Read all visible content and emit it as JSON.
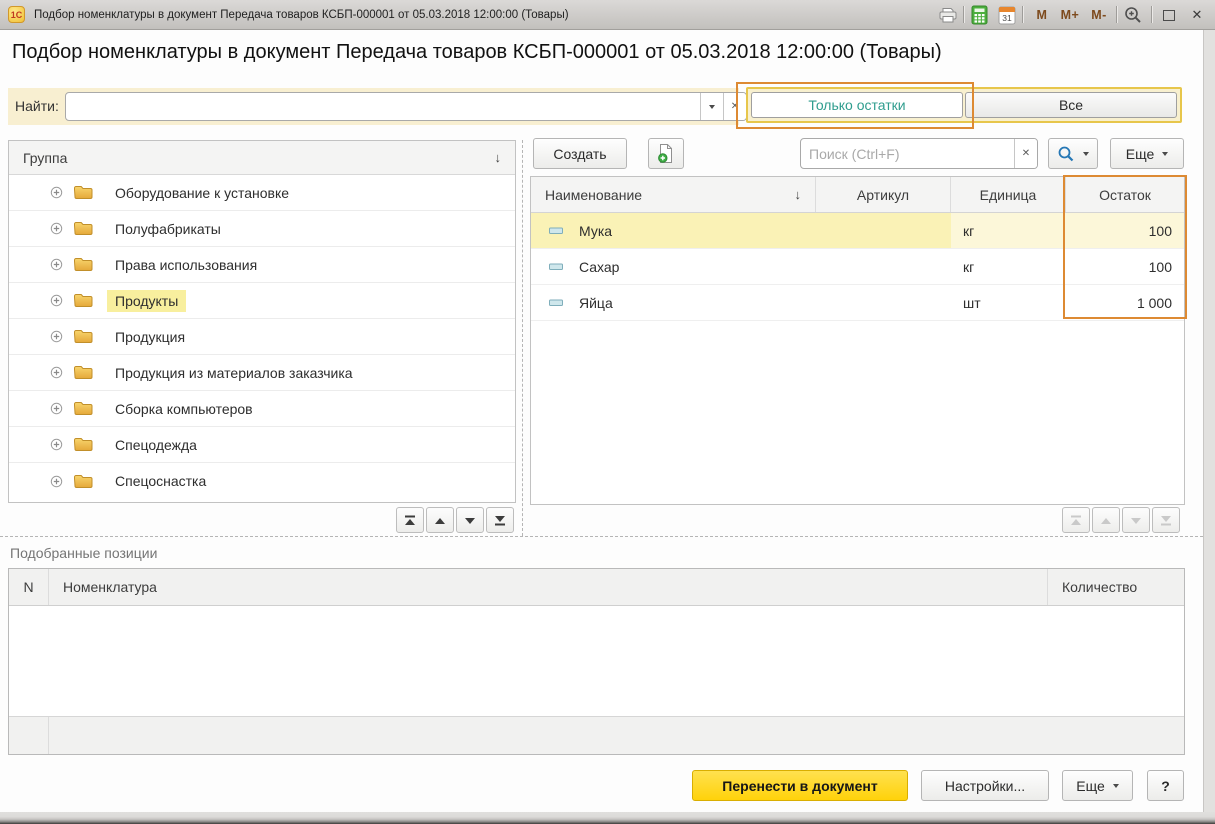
{
  "window": {
    "logo": "1С",
    "title": "Подбор номенклатуры в документ Передача товаров КСБП-000001 от 05.03.2018 12:00:00 (Товары)",
    "memory_buttons": [
      "M",
      "M+",
      "M-"
    ],
    "calendar_day": "31"
  },
  "heading": "Подбор номенклатуры в документ Передача товаров КСБП-000001 от 05.03.2018 12:00:00 (Товары)",
  "glyphs": {
    "close": "✕",
    "clear": "✕",
    "sort_down": "↓"
  },
  "find": {
    "label": "Найти:",
    "value": ""
  },
  "filter": {
    "only_stock_label": "Только остатки",
    "all_label": "Все",
    "active": "Только остатки"
  },
  "tree": {
    "header": "Группа",
    "items": [
      "Оборудование к установке",
      "Полуфабрикаты",
      "Права использования",
      "Продукты",
      "Продукция",
      "Продукция из материалов заказчика",
      "Сборка компьютеров",
      "Спецодежда",
      "Спецоснастка"
    ],
    "selected_item": "Продукты"
  },
  "list": {
    "create_label": "Создать",
    "search_placeholder": "Поиск (Ctrl+F)",
    "more_label": "Еще",
    "columns": [
      "Наименование",
      "Артикул",
      "Единица",
      "Остаток"
    ],
    "rows": [
      {
        "name": "Мука",
        "article": "",
        "unit": "кг",
        "stock": "100"
      },
      {
        "name": "Сахар",
        "article": "",
        "unit": "кг",
        "stock": "100"
      },
      {
        "name": "Яйца",
        "article": "",
        "unit": "шт",
        "stock": "1 000"
      }
    ]
  },
  "picked": {
    "label": "Подобранные позиции",
    "columns": [
      "N",
      "Номенклатура",
      "Количество"
    ]
  },
  "footer": {
    "transfer_label": "Перенести в документ",
    "settings_label": "Настройки...",
    "more_label": "Еще",
    "help_label": "?"
  },
  "colors": {
    "annotation_orange": "#dd8a33",
    "highlight_gold": "#e7c64b",
    "selection_yellow": "#faf2b6",
    "tree_highlight_yellow": "#f8ef9e",
    "action_button_yellow": "#ffd20a",
    "active_toggle_teal": "#2f9d8e",
    "find_band_cream": "#f8efd1"
  }
}
